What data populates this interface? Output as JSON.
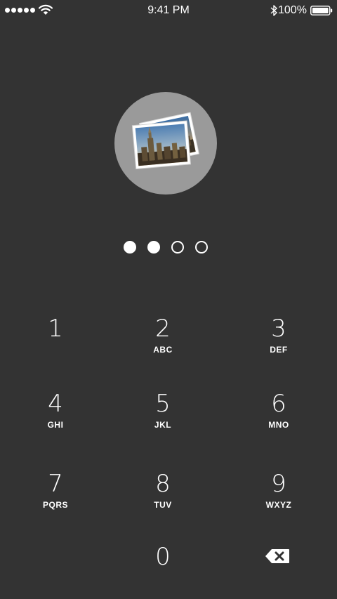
{
  "status_bar": {
    "time": "9:41 PM",
    "battery": "100%",
    "signal_icon": "signal-dots-icon",
    "wifi_icon": "wifi-icon",
    "bluetooth_icon": "bluetooth-icon",
    "battery_icon": "battery-icon"
  },
  "avatar": {
    "icon": "photos-icon",
    "background_color": "#9a9a9a"
  },
  "passcode": {
    "entered": 2,
    "length": 4
  },
  "keypad": {
    "keys": [
      {
        "digit": "1",
        "letters": ""
      },
      {
        "digit": "2",
        "letters": "ABC"
      },
      {
        "digit": "3",
        "letters": "DEF"
      },
      {
        "digit": "4",
        "letters": "GHI"
      },
      {
        "digit": "5",
        "letters": "JKL"
      },
      {
        "digit": "6",
        "letters": "MNO"
      },
      {
        "digit": "7",
        "letters": "PQRS"
      },
      {
        "digit": "8",
        "letters": "TUV"
      },
      {
        "digit": "9",
        "letters": "WXYZ"
      },
      {
        "digit": "0",
        "letters": ""
      }
    ],
    "delete_icon": "backspace-icon"
  },
  "colors": {
    "background": "#333333",
    "foreground": "#ffffff"
  }
}
